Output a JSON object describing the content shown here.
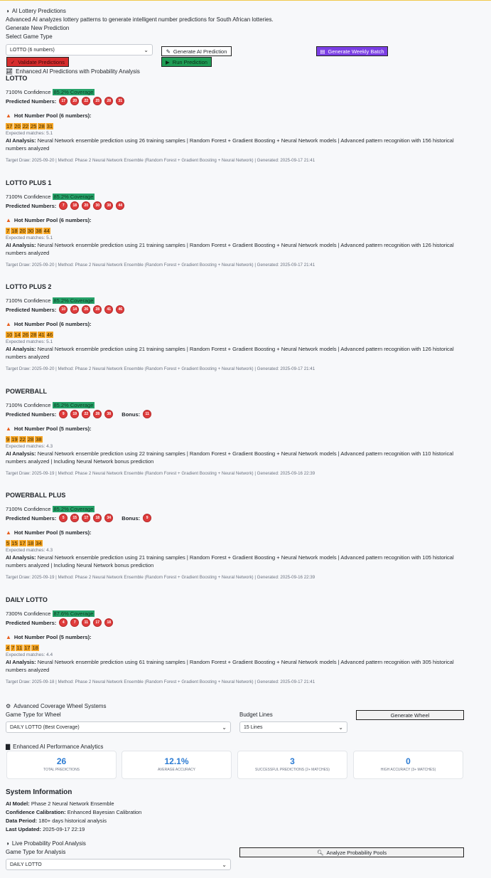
{
  "header": {
    "title": "AI Lottery Predictions",
    "subtitle": "Advanced AI analyzes lottery patterns to generate intelligent number predictions for South African lotteries.",
    "section_title": "Generate New Prediction",
    "select_label": "Select Game Type",
    "select_value": "LOTTO (6 numbers)",
    "btn_generate": "Generate AI Prediction",
    "btn_weekly": "Generate Weekly Batch",
    "btn_validate": "Validate Predictions",
    "btn_run": "Run Prediction",
    "enhanced_title": "Enhanced AI Predictions with Probability Analysis"
  },
  "labels": {
    "confidence_suffix": "Confidence",
    "predicted": "Predicted Numbers:",
    "bonus": "Bonus:",
    "analysis": "AI Analysis:"
  },
  "games": [
    {
      "name": "LOTTO",
      "confidence": "7100%",
      "coverage": "85.2% Coverage",
      "numbers": [
        "17",
        "20",
        "22",
        "25",
        "28",
        "31"
      ],
      "bonus": "",
      "pool_title": "Hot Number Pool (6 numbers):",
      "pool": [
        "17",
        "20",
        "22",
        "25",
        "28",
        "31"
      ],
      "expected": "Expected matches: 5.1",
      "analysis": "Neural Network ensemble prediction using 26 training samples | Random Forest + Gradient Boosting + Neural Network models | Advanced pattern recognition with 156 historical numbers analyzed",
      "meta": "Target Draw: 2025-09-20 | Method: Phase 2 Neural Network Ensemble (Random Forest + Gradient Boosting + Neural Network) | Generated: 2025-09-17 21:41"
    },
    {
      "name": "LOTTO PLUS 1",
      "confidence": "7100%",
      "coverage": "85.2% Coverage",
      "numbers": [
        "7",
        "18",
        "20",
        "30",
        "38",
        "44"
      ],
      "bonus": "",
      "pool_title": "Hot Number Pool (6 numbers):",
      "pool": [
        "7",
        "18",
        "20",
        "30",
        "38",
        "44"
      ],
      "expected": "Expected matches: 5.1",
      "analysis": "Neural Network ensemble prediction using 21 training samples | Random Forest + Gradient Boosting + Neural Network models | Advanced pattern recognition with 126 historical numbers analyzed",
      "meta": "Target Draw: 2025-09-20 | Method: Phase 2 Neural Network Ensemble (Random Forest + Gradient Boosting + Neural Network) | Generated: 2025-09-17 21:41"
    },
    {
      "name": "LOTTO PLUS 2",
      "confidence": "7100%",
      "coverage": "85.2% Coverage",
      "numbers": [
        "10",
        "14",
        "26",
        "28",
        "41",
        "46"
      ],
      "bonus": "",
      "pool_title": "Hot Number Pool (6 numbers):",
      "pool": [
        "10",
        "14",
        "26",
        "28",
        "41",
        "46"
      ],
      "expected": "Expected matches: 5.1",
      "analysis": "Neural Network ensemble prediction using 21 training samples | Random Forest + Gradient Boosting + Neural Network models | Advanced pattern recognition with 126 historical numbers analyzed",
      "meta": "Target Draw: 2025-09-20 | Method: Phase 2 Neural Network Ensemble (Random Forest + Gradient Boosting + Neural Network) | Generated: 2025-09-17 21:41"
    },
    {
      "name": "POWERBALL",
      "confidence": "7100%",
      "coverage": "85.2% Coverage",
      "numbers": [
        "9",
        "19",
        "22",
        "28",
        "38"
      ],
      "bonus": "11",
      "pool_title": "Hot Number Pool (5 numbers):",
      "pool": [
        "9",
        "19",
        "22",
        "28",
        "38"
      ],
      "expected": "Expected matches: 4.3",
      "analysis": "Neural Network ensemble prediction using 22 training samples | Random Forest + Gradient Boosting + Neural Network models | Advanced pattern recognition with 110 historical numbers analyzed | Including Neural Network bonus prediction",
      "meta": "Target Draw: 2025-09-19 | Method: Phase 2 Neural Network Ensemble (Random Forest + Gradient Boosting + Neural Network) | Generated: 2025-09-16 22:39"
    },
    {
      "name": "POWERBALL PLUS",
      "confidence": "7100%",
      "coverage": "85.2% Coverage",
      "numbers": [
        "5",
        "15",
        "17",
        "18",
        "34"
      ],
      "bonus": "9",
      "pool_title": "Hot Number Pool (5 numbers):",
      "pool": [
        "5",
        "15",
        "17",
        "18",
        "34"
      ],
      "expected": "Expected matches: 4.3",
      "analysis": "Neural Network ensemble prediction using 21 training samples | Random Forest + Gradient Boosting + Neural Network models | Advanced pattern recognition with 105 historical numbers analyzed | Including Neural Network bonus prediction",
      "meta": "Target Draw: 2025-09-19 | Method: Phase 2 Neural Network Ensemble (Random Forest + Gradient Boosting + Neural Network) | Generated: 2025-09-16 22:39"
    },
    {
      "name": "DAILY LOTTO",
      "confidence": "7300%",
      "coverage": "87.6% Coverage",
      "numbers": [
        "4",
        "7",
        "11",
        "17",
        "18"
      ],
      "bonus": "",
      "pool_title": "Hot Number Pool (5 numbers):",
      "pool": [
        "4",
        "7",
        "11",
        "17",
        "18"
      ],
      "expected": "Expected matches: 4.4",
      "analysis": "Neural Network ensemble prediction using 61 training samples | Random Forest + Gradient Boosting + Neural Network models | Advanced pattern recognition with 305 historical numbers analyzed",
      "meta": "Target Draw: 2025-09-18 | Method: Phase 2 Neural Network Ensemble (Random Forest + Gradient Boosting + Neural Network) | Generated: 2025-09-17 21:41"
    }
  ],
  "wheel": {
    "title": "Advanced Coverage Wheel Systems",
    "game_label": "Game Type for Wheel",
    "game_value": "DAILY LOTTO (Best Coverage)",
    "budget_label": "Budget Lines",
    "budget_value": "15 Lines",
    "button": "Generate Wheel"
  },
  "analytics": {
    "title": "Enhanced AI Performance Analytics",
    "cards": [
      {
        "value": "26",
        "label": "Total Predictions"
      },
      {
        "value": "12.1%",
        "label": "Average Accuracy"
      },
      {
        "value": "3",
        "label": "Successful Predictions (2+ Matches)"
      },
      {
        "value": "0",
        "label": "High Accuracy (3+ Matches)"
      }
    ]
  },
  "system": {
    "title": "System Information",
    "rows": [
      {
        "key": "AI Model:",
        "value": "Phase 2 Neural Network Ensemble"
      },
      {
        "key": "Confidence Calibration:",
        "value": "Enhanced Bayesian Calibration"
      },
      {
        "key": "Data Period:",
        "value": "180+ days historical analysis"
      },
      {
        "key": "Last Updated:",
        "value": "2025-09-17 22:19"
      }
    ]
  },
  "pool": {
    "title": "Live Probability Pool Analysis",
    "label": "Game Type for Analysis",
    "value": "DAILY LOTTO",
    "button": "Analyze Probability Pools"
  },
  "colors": {
    "ball": "#e03c3c",
    "coverage": "#26a269",
    "hot": "#f5a524",
    "weekly": "#7b3fe4",
    "validate": "#d62d2d",
    "run": "#1f9d55",
    "accent": "#2b7bd3"
  }
}
